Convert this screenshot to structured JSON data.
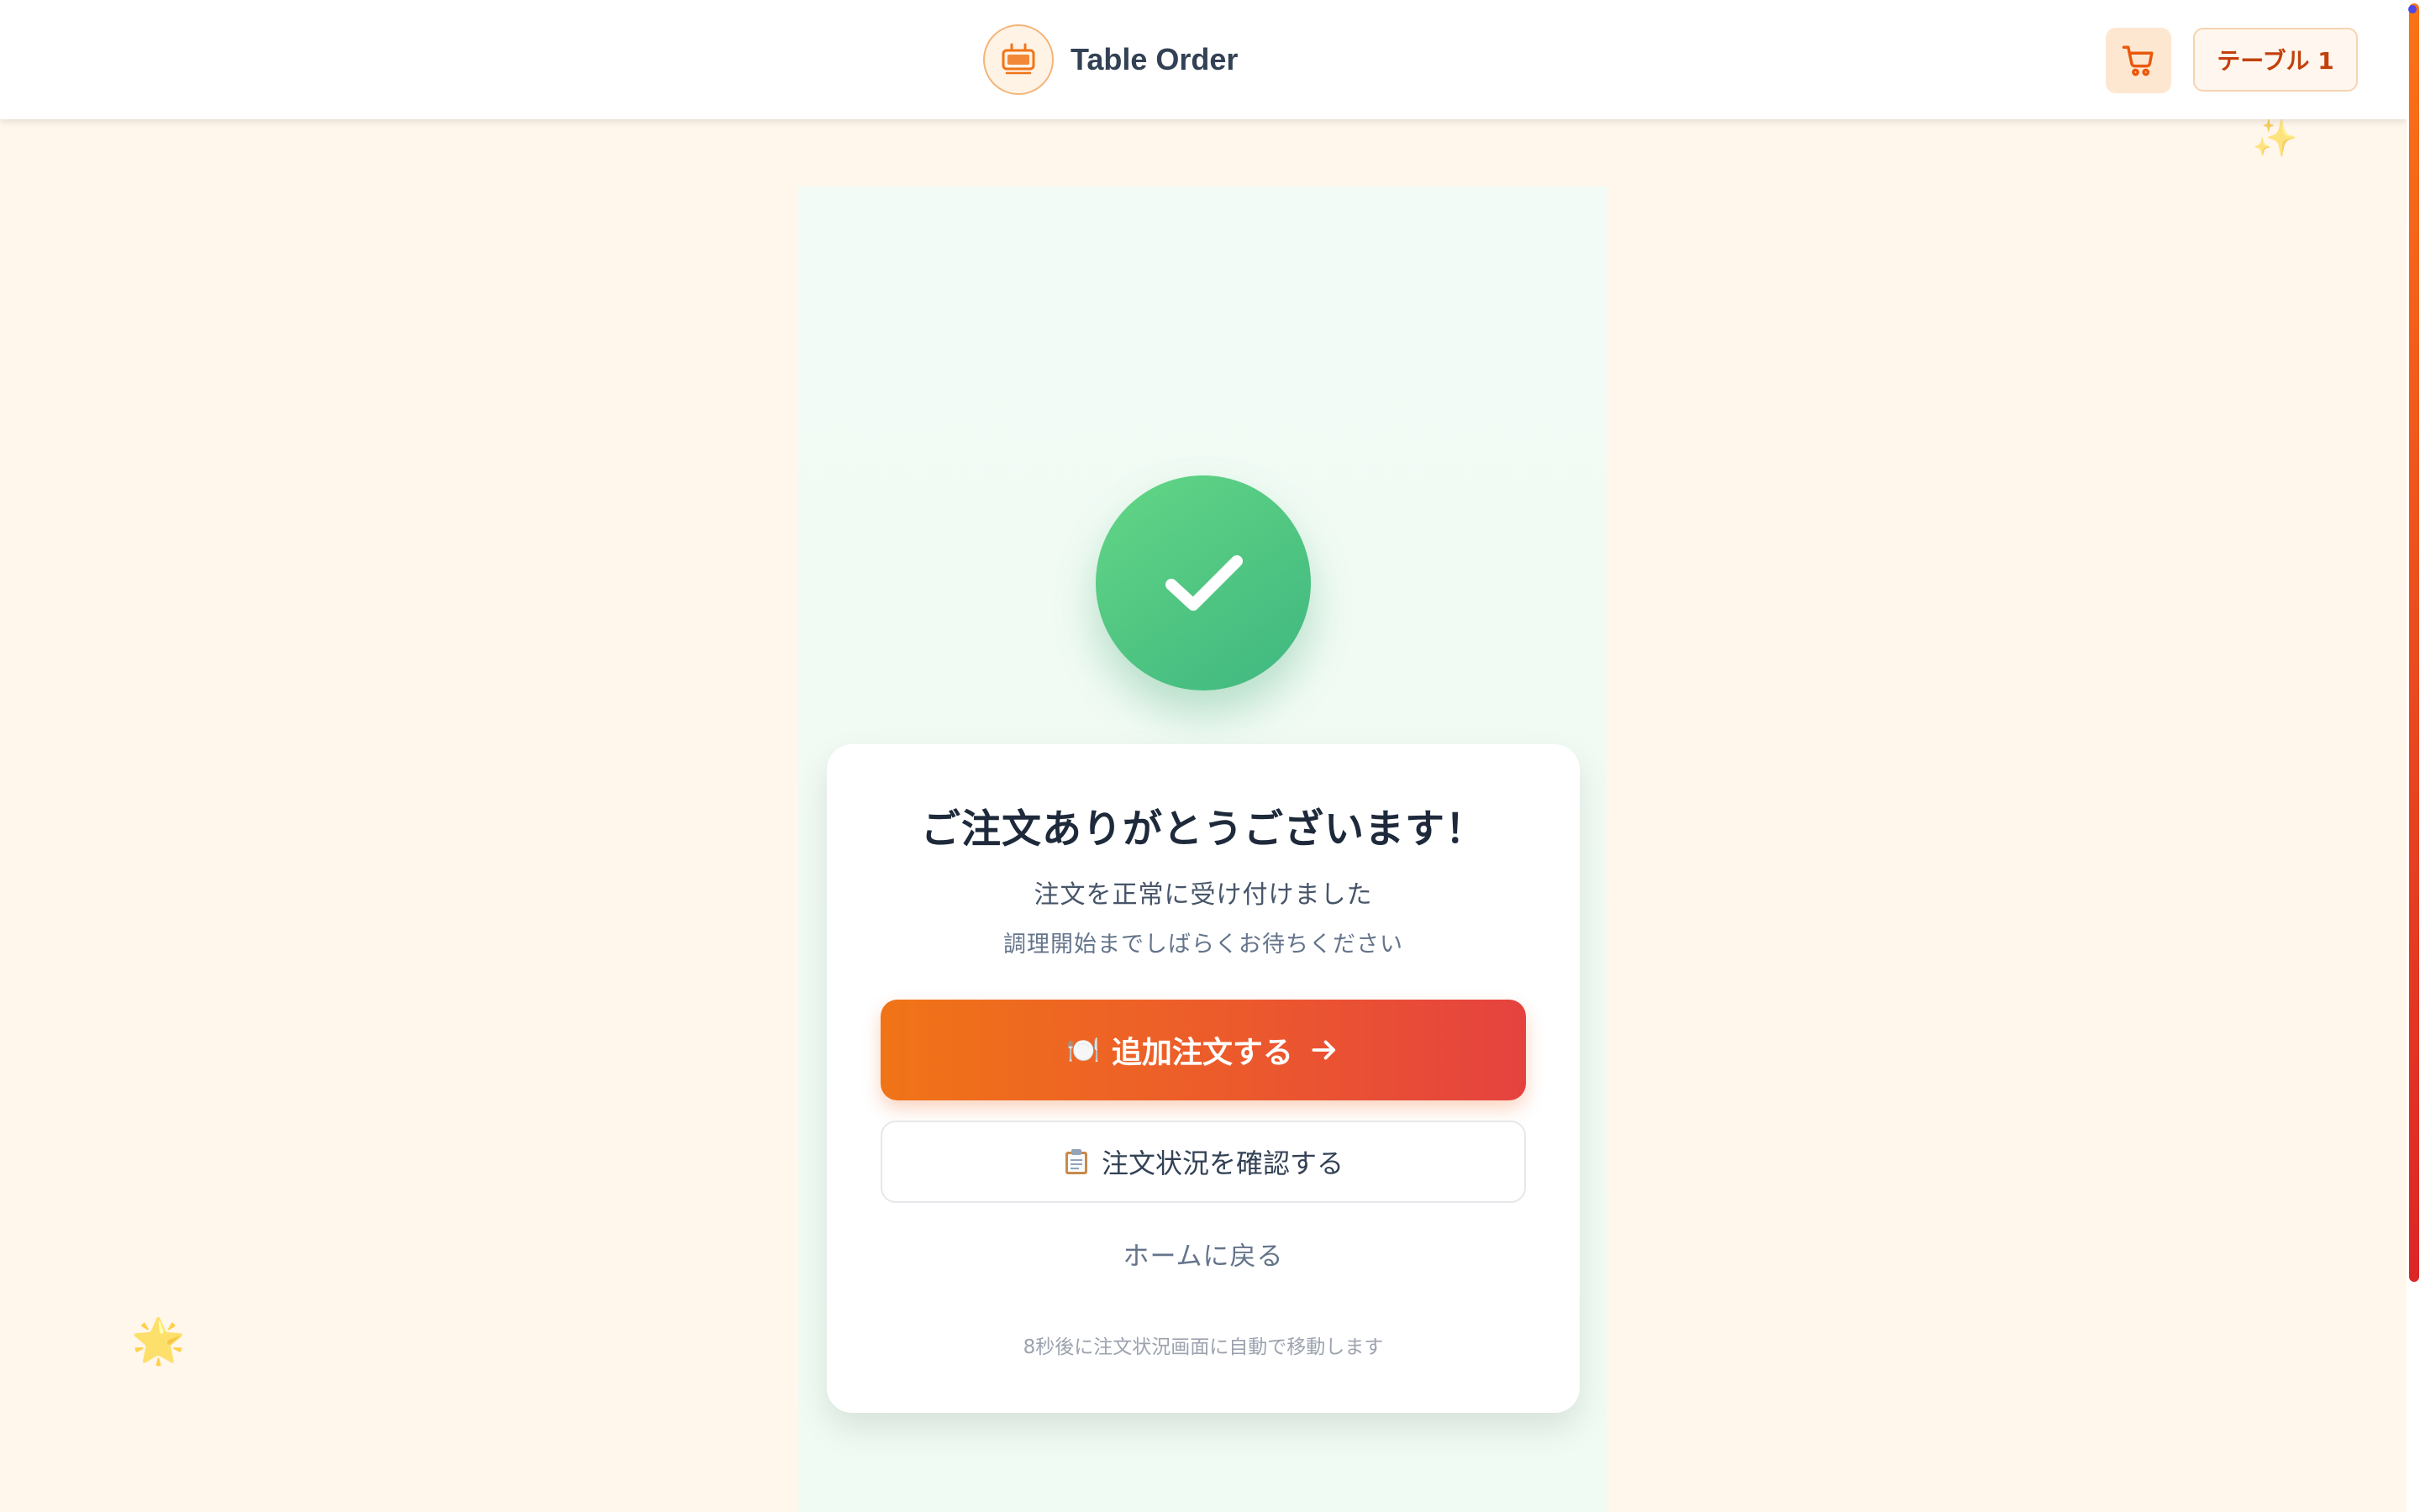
{
  "header": {
    "brand_name": "Table Order",
    "logo_icon": "tv-icon",
    "cart_icon": "cart-icon",
    "table_label": "テーブル 1"
  },
  "decor": {
    "sparkle": "✨",
    "star": "🌟"
  },
  "confirmation": {
    "status_icon": "check-icon",
    "title": "ご注文ありがとうございます！",
    "subtitle": "注文を正常に受け付けました",
    "note": "調理開始までしばらくお待ちください",
    "primary_button": {
      "emoji": "🍽️",
      "label": "追加注文する",
      "icon": "arrow-right-icon"
    },
    "secondary_button": {
      "icon": "clipboard-icon",
      "label": "注文状況を確認する"
    },
    "home_link": "ホームに戻る",
    "auto_redirect_note": "8秒後に注文状況画面に自動で移動します"
  },
  "colors": {
    "accent_orange": "#f97316",
    "accent_red": "#e5423f",
    "success_green": "#4cc57f",
    "page_bg": "#fff6ec"
  }
}
